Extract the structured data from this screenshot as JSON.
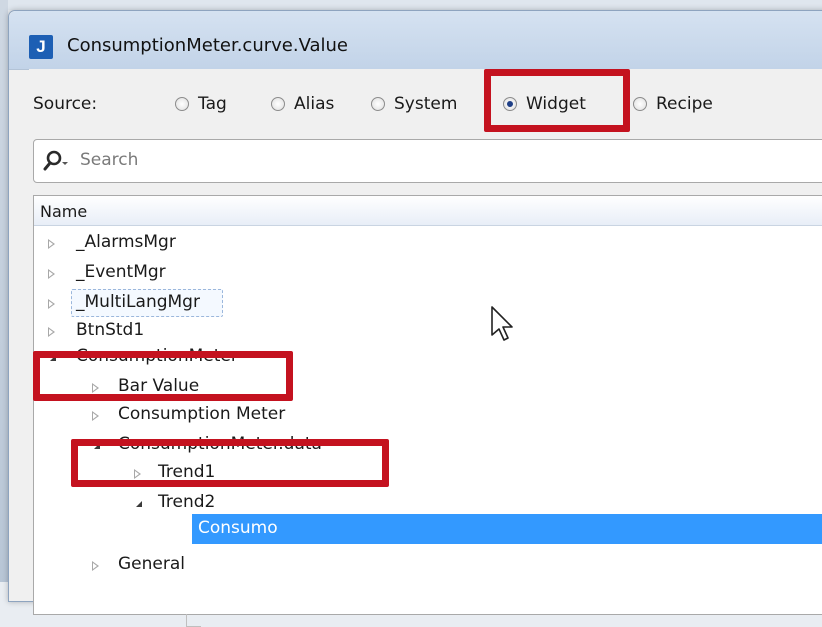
{
  "window": {
    "title": "ConsumptionMeter.curve.Value",
    "icon_letter": "J"
  },
  "source": {
    "label": "Source:",
    "options": [
      "Tag",
      "Alias",
      "System",
      "Widget",
      "Recipe"
    ],
    "selected": "Widget"
  },
  "search": {
    "placeholder": "Search"
  },
  "tree": {
    "header": "Name",
    "items": [
      {
        "label": "_AlarmsMgr",
        "level": 0,
        "state": "collapsed"
      },
      {
        "label": "_EventMgr",
        "level": 0,
        "state": "collapsed"
      },
      {
        "label": "_MultiLangMgr",
        "level": 0,
        "state": "collapsed"
      },
      {
        "label": "BtnStd1",
        "level": 0,
        "state": "collapsed"
      },
      {
        "label": "ConsumptionMeter",
        "level": 0,
        "state": "expanded"
      },
      {
        "label": "Bar Value",
        "level": 1,
        "state": "collapsed"
      },
      {
        "label": "Consumption Meter",
        "level": 1,
        "state": "collapsed"
      },
      {
        "label": "ConsumptionMeter.data",
        "level": 1,
        "state": "expanded"
      },
      {
        "label": "Trend1",
        "level": 2,
        "state": "collapsed"
      },
      {
        "label": "Trend2",
        "level": 2,
        "state": "expanded"
      },
      {
        "label": "Consumo",
        "level": 3,
        "state": "leaf",
        "selected": true
      },
      {
        "label": "General",
        "level": 1,
        "state": "collapsed"
      }
    ]
  },
  "colors": {
    "selection": "#3399ff",
    "highlight_box": "#c4121f",
    "app_icon": "#1d5fb4"
  }
}
